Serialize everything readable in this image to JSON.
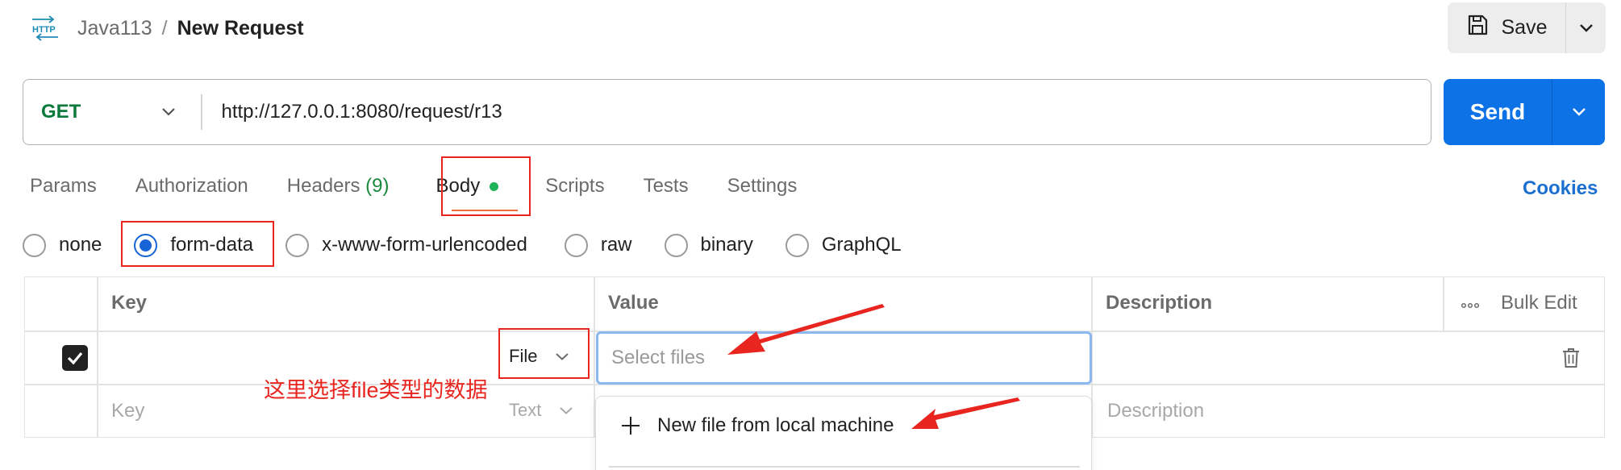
{
  "header": {
    "http_icon_text": "HTTP",
    "breadcrumb_parent": "Java113",
    "breadcrumb_separator": "/",
    "title": "New Request",
    "save_label": "Save"
  },
  "request": {
    "method": "GET",
    "url": "http://127.0.0.1:8080/request/r13",
    "send_label": "Send"
  },
  "tabs": {
    "params": "Params",
    "authorization": "Authorization",
    "headers": "Headers",
    "headers_count": "(9)",
    "body": "Body",
    "scripts": "Scripts",
    "tests": "Tests",
    "settings": "Settings",
    "cookies": "Cookies"
  },
  "body_types": {
    "none": "none",
    "form_data": "form-data",
    "urlencoded": "x-www-form-urlencoded",
    "raw": "raw",
    "binary": "binary",
    "graphql": "GraphQL",
    "selected": "form-data"
  },
  "table": {
    "headers": {
      "key": "Key",
      "value": "Value",
      "description": "Description",
      "bulk_edit": "Bulk Edit"
    },
    "row1": {
      "checked": true,
      "type": "File",
      "value_placeholder": "Select files"
    },
    "row2": {
      "key_placeholder": "Key",
      "type": "Text",
      "description_placeholder": "Description"
    }
  },
  "dropdown": {
    "new_file": "New file from local machine"
  },
  "annotation": {
    "text": "这里选择file类型的数据",
    "color": "#e8261f"
  },
  "colors": {
    "accent_blue": "#0c72e6",
    "method_green": "#0b7a3c",
    "tab_underline": "#f26b3a",
    "annotation_red": "#e8261f"
  }
}
